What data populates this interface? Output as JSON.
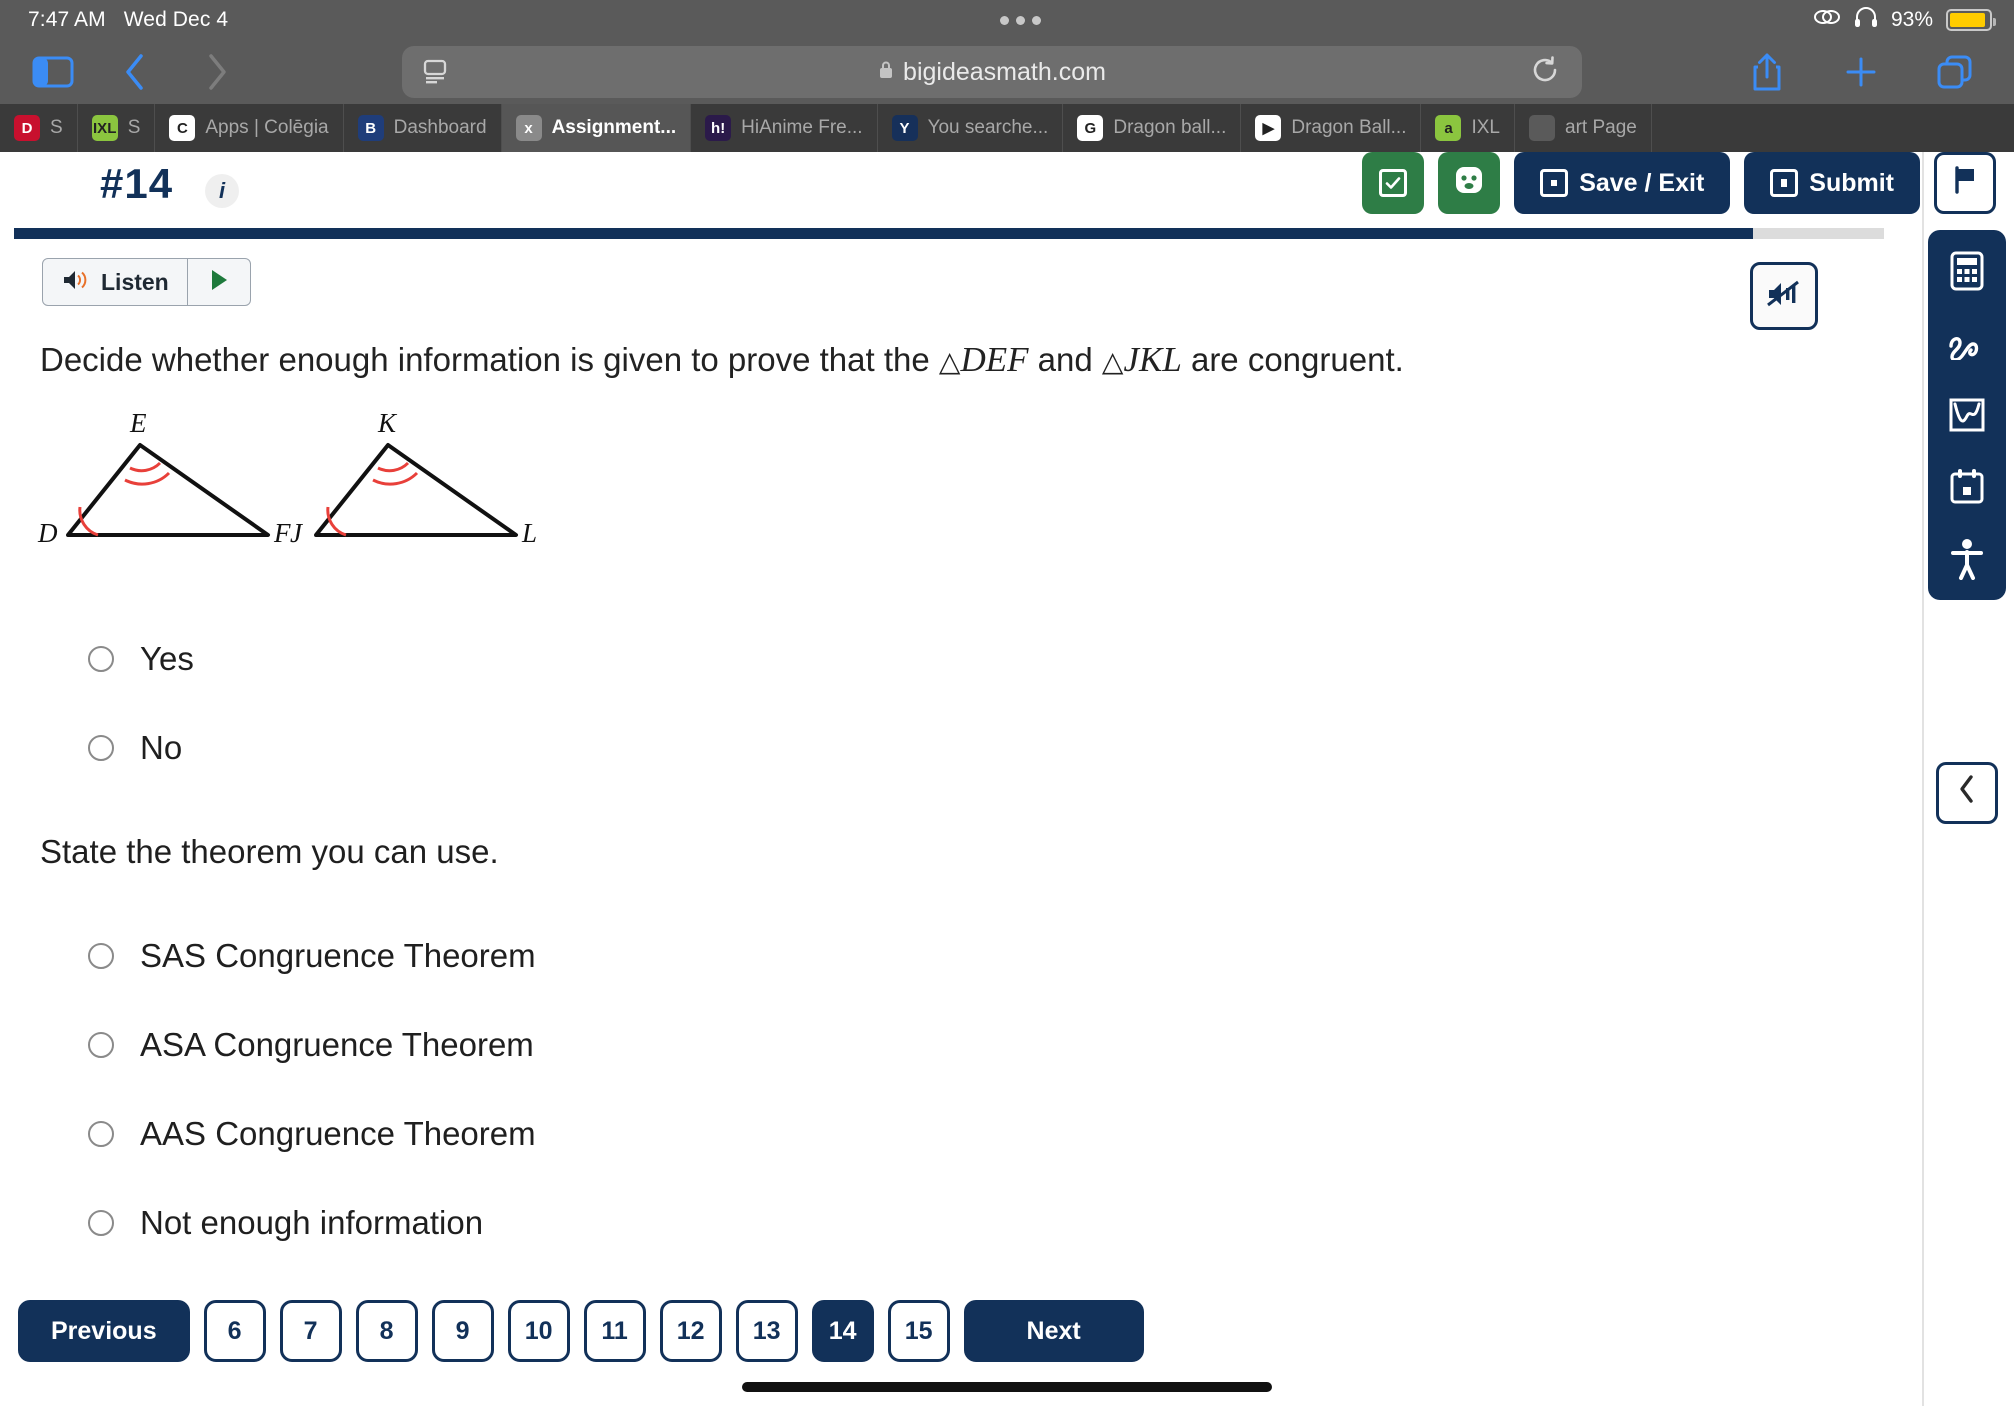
{
  "status_bar": {
    "time": "7:47 AM",
    "date": "Wed Dec 4",
    "battery_percent": "93%",
    "icons": [
      "screen-mirroring-icon",
      "headphones-icon",
      "battery-icon"
    ]
  },
  "browser": {
    "url": "bigideasmath.com",
    "lock_icon": "lock-icon",
    "back_label": "‹",
    "forward_label": "›",
    "tabs": [
      {
        "label": "S",
        "fav": "D",
        "fav_color": "#c8102e",
        "active": false
      },
      {
        "label": "S",
        "fav": "IXL",
        "fav_color": "#8bc53f",
        "active": false
      },
      {
        "label": "Apps | Colēgia",
        "fav": "C",
        "fav_color": "#ffffff",
        "active": false
      },
      {
        "label": "Dashboard",
        "fav": "B",
        "fav_color": "#1f3d7a",
        "active": false
      },
      {
        "label": "Assignment...",
        "fav": "x",
        "fav_color": "#8a8a8a",
        "active": true
      },
      {
        "label": "HiAnime Fre...",
        "fav": "h!",
        "fav_color": "#2b1a4a",
        "active": false
      },
      {
        "label": "You searche...",
        "fav": "Y",
        "fav_color": "#16305a",
        "active": false
      },
      {
        "label": "Dragon ball...",
        "fav": "G",
        "fav_color": "#ffffff",
        "active": false
      },
      {
        "label": "Dragon Ball...",
        "fav": "▶",
        "fav_color": "#ffffff",
        "active": false
      },
      {
        "label": "IXL",
        "fav": "a",
        "fav_color": "#8bc53f",
        "active": false
      },
      {
        "label": "art Page",
        "fav": "",
        "fav_color": "#5a5a5a",
        "active": false
      }
    ]
  },
  "app_header": {
    "question_number": "#14",
    "info_label": "i",
    "buttons": [
      {
        "name": "check-answer-button",
        "label": "",
        "style": "green"
      },
      {
        "name": "help-button",
        "label": "",
        "style": "green"
      },
      {
        "name": "save-exit-button",
        "label": "Save / Exit",
        "style": "navy"
      },
      {
        "name": "submit-button",
        "label": "Submit",
        "style": "navy"
      },
      {
        "name": "flag-button",
        "label": "",
        "style": "white"
      }
    ],
    "progress_percent": 93
  },
  "listen_bar": {
    "label": "Listen",
    "speaker_icon": "speaker-icon",
    "play_icon": "play-icon"
  },
  "question": {
    "prompt_before": "Decide whether enough information is given to prove that the",
    "triangle_1": "DEF",
    "prompt_middle": "and",
    "triangle_2": "JKL",
    "prompt_after": "are congruent.",
    "yes_no_options": [
      {
        "label": "Yes",
        "selected": false
      },
      {
        "label": "No",
        "selected": false
      }
    ],
    "sub_prompt": "State the theorem you can use.",
    "theorem_options": [
      {
        "label": "SAS Congruence Theorem",
        "selected": false
      },
      {
        "label": "ASA Congruence Theorem",
        "selected": false
      },
      {
        "label": "AAS Congruence Theorem",
        "selected": false
      },
      {
        "label": "Not enough information",
        "selected": false
      }
    ]
  },
  "figure": {
    "triangle_def": {
      "vertices": [
        "D",
        "E",
        "F"
      ],
      "marks": {
        "D": "single-arc",
        "E": "double-arc",
        "F": "none"
      }
    },
    "triangle_jkl": {
      "vertices": [
        "J",
        "K",
        "L"
      ],
      "marks": {
        "J": "single-arc",
        "K": "double-arc",
        "L": "none"
      }
    },
    "mark_color": "#e8403a"
  },
  "tool_rail": {
    "mute_icon": "speaker-mute-icon",
    "collapse_icon": "chevron-left-icon",
    "tools": [
      {
        "name": "calculator-icon",
        "label": "Calculator"
      },
      {
        "name": "scribble-icon",
        "label": "Scribble"
      },
      {
        "name": "graph-icon",
        "label": "Graph"
      },
      {
        "name": "notes-icon",
        "label": "Notes"
      },
      {
        "name": "accessibility-icon",
        "label": "Accessibility"
      }
    ]
  },
  "pagination": {
    "previous_label": "Previous",
    "next_label": "Next",
    "pages": [
      "6",
      "7",
      "8",
      "9",
      "10",
      "11",
      "12",
      "13",
      "14",
      "15"
    ],
    "current_page": "14"
  },
  "colors": {
    "navy": "#123159",
    "green": "#2e7d46",
    "accent_red": "#e8403a",
    "battery_yellow": "#ffcc00"
  }
}
